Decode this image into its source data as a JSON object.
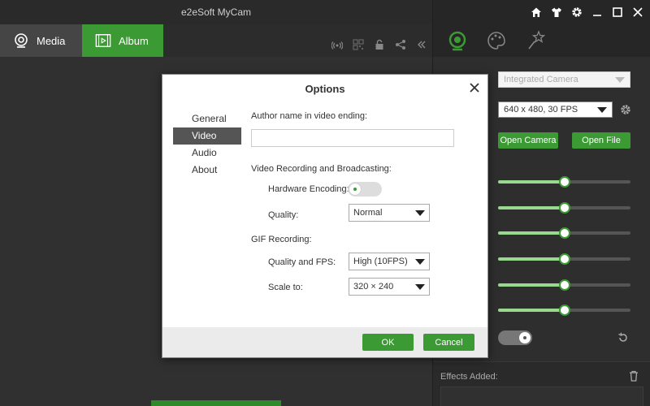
{
  "app": {
    "title": "e2eSoft MyCam"
  },
  "tabs": [
    {
      "label": "Media",
      "icon": "webcam-icon"
    },
    {
      "label": "Album",
      "icon": "film-icon"
    }
  ],
  "toolbar_icons": [
    "broadcast-icon",
    "qr-icon",
    "lock-icon",
    "share-icon",
    "collapse-icon"
  ],
  "window_controls": [
    "home-icon",
    "shirt-icon",
    "settings-icon",
    "minimize-icon",
    "maximize-icon",
    "close-icon"
  ],
  "right_tabs": [
    "camera-tab-icon",
    "palette-tab-icon",
    "effects-tab-icon"
  ],
  "camera_panel": {
    "camera_select": "Integrated Camera",
    "resolution_select": "640 x 480, 30 FPS",
    "open_camera_label": "Open Camera",
    "open_file_label": "Open File",
    "sliders": [
      0.5,
      0.5,
      0.5,
      0.5,
      0.5,
      0.5
    ],
    "toggle_on": true
  },
  "effects": {
    "label": "Effects Added:"
  },
  "dialog": {
    "title": "Options",
    "nav": [
      "General",
      "Video",
      "Audio",
      "About"
    ],
    "active_nav": "Video",
    "author_label": "Author name in video ending:",
    "author_value": "",
    "video_section": "Video Recording and Broadcasting:",
    "hw_encoding_label": "Hardware Encoding:",
    "hw_encoding_on": false,
    "quality_label": "Quality:",
    "quality_value": "Normal",
    "gif_section": "GIF Recording:",
    "gif_quality_label": "Quality and FPS:",
    "gif_quality_value": "High (10FPS)",
    "scale_label": "Scale to:",
    "scale_value": "320 × 240",
    "ok_label": "OK",
    "cancel_label": "Cancel"
  },
  "colors": {
    "accent": "#3c9a35",
    "dark": "#2b2b2b"
  }
}
